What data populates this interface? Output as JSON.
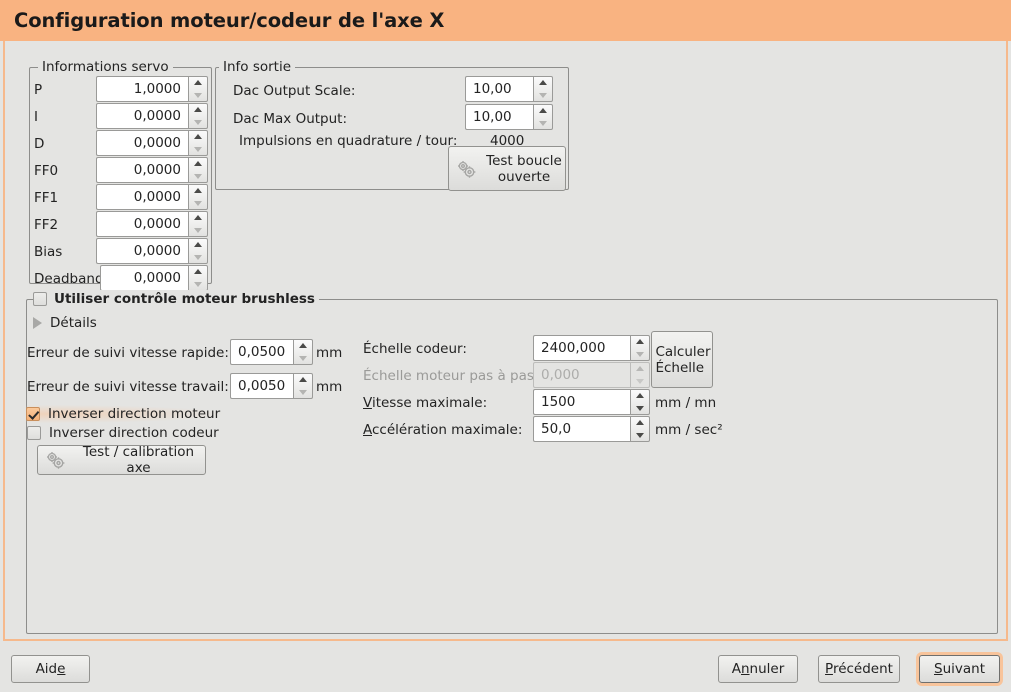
{
  "window": {
    "title": "Configuration moteur/codeur de l'axe X",
    "accent_color": "#f9b381",
    "focus_ring_color": "#f8c49b",
    "background_color": "#e4e4e2"
  },
  "servo_group": {
    "title": "Informations servo",
    "rows": [
      {
        "label": "P",
        "value": "1,0000"
      },
      {
        "label": "I",
        "value": "0,0000"
      },
      {
        "label": "D",
        "value": "0,0000"
      },
      {
        "label": "FF0",
        "value": "0,0000"
      },
      {
        "label": "FF1",
        "value": "0,0000"
      },
      {
        "label": "FF2",
        "value": "0,0000"
      },
      {
        "label": "Bias",
        "value": "0,0000"
      },
      {
        "label": "Deadband",
        "value": "0,0000"
      }
    ]
  },
  "output_group": {
    "title": "Info sortie",
    "dac_output_scale_label": "Dac Output Scale:",
    "dac_output_scale_value": "10,00",
    "dac_max_output_label": "Dac Max Output:",
    "dac_max_output_value": "10,00",
    "quadrature_label": "Impulsions en quadrature / tour:",
    "quadrature_value": "4000",
    "test_open_loop_button": "Test boucle\nouverte",
    "test_open_loop_icon": "gears-icon"
  },
  "brushless_group": {
    "title": "Utiliser contrôle moteur brushless",
    "checked": false,
    "details_label": "Détails",
    "details_expanded": false,
    "ferror_fast_label": "Erreur de suivi vitesse rapide:",
    "ferror_fast_value": "0,0500",
    "ferror_fast_unit": "mm",
    "ferror_slow_label": "Erreur de suivi vitesse travail:",
    "ferror_slow_value": "0,0050",
    "ferror_slow_unit": "mm",
    "invert_motor_label": "Inverser direction moteur",
    "invert_motor_checked": true,
    "invert_encoder_label": "Inverser direction codeur",
    "invert_encoder_checked": false,
    "test_axis_button": "Test / calibration axe",
    "test_axis_icon": "gears-icon",
    "encoder_scale_label": "Échelle codeur:",
    "encoder_scale_value": "2400,000",
    "stepper_scale_label": "Échelle moteur pas à pas:",
    "stepper_scale_value": "0,000",
    "stepper_scale_disabled": true,
    "calc_scale_button": "Calculer\nÉchelle",
    "max_velocity_label": "Vitesse maximale:",
    "max_velocity_mnemonic": "V",
    "max_velocity_label_rest": "itesse maximale:",
    "max_velocity_value": "1500",
    "max_velocity_unit": "mm / mn",
    "max_accel_label": "Accélération maximale:",
    "max_accel_mnemonic": "A",
    "max_accel_label_rest": "ccélération maximale:",
    "max_accel_value": "50,0",
    "max_accel_unit": "mm / sec²"
  },
  "actions": {
    "help_pre": "Aid",
    "help_mnemonic": "e",
    "cancel_pre": "A",
    "cancel_mnemonic": "n",
    "cancel_post": "nuler",
    "back_mnemonic": "P",
    "back_post": "récédent",
    "next_mnemonic": "S",
    "next_post": "uivant",
    "next_focused": true
  }
}
